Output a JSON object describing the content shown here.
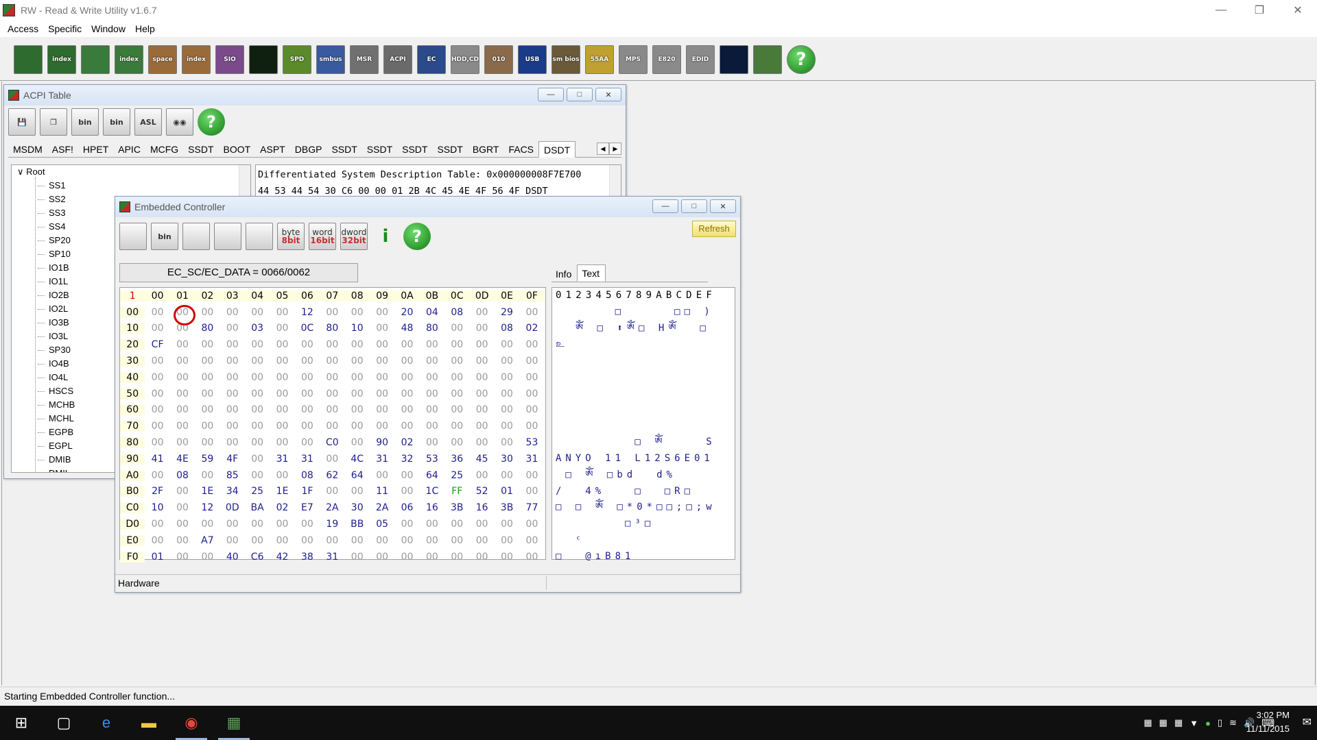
{
  "window": {
    "title": "RW - Read & Write Utility v1.6.7"
  },
  "menu": [
    "Access",
    "Specific",
    "Window",
    "Help"
  ],
  "toolbar": [
    {
      "icon": "pci-icon",
      "label": "",
      "bg": "#2e6b2e"
    },
    {
      "icon": "pci-index-icon",
      "label": "index",
      "bg": "#2e6b2e"
    },
    {
      "icon": "memory-icon",
      "label": "",
      "bg": "#3a7a3a"
    },
    {
      "icon": "memory-index-icon",
      "label": "index",
      "bg": "#3a7a3a"
    },
    {
      "icon": "io-space-icon",
      "label": "space",
      "bg": "#9a6b3a"
    },
    {
      "icon": "io-index-icon",
      "label": "index",
      "bg": "#9a6b3a"
    },
    {
      "icon": "super-io-icon",
      "label": "SIO",
      "bg": "#7a4a8a"
    },
    {
      "icon": "oscilloscope-icon",
      "label": "",
      "bg": "#102010"
    },
    {
      "icon": "spd-icon",
      "label": "SPD",
      "bg": "#5a8a2a"
    },
    {
      "icon": "smbus-icon",
      "label": "smbus",
      "bg": "#3a5aa0"
    },
    {
      "icon": "msr-icon",
      "label": "MSR",
      "bg": "#707070"
    },
    {
      "icon": "acpi-icon",
      "label": "ACPI",
      "bg": "#6a6a6a"
    },
    {
      "icon": "ec-icon",
      "label": "EC",
      "bg": "#2a4a8a"
    },
    {
      "icon": "hdd-icon",
      "label": "HDD,CD",
      "bg": "#8a8a8a"
    },
    {
      "icon": "cmos-icon",
      "label": "010",
      "bg": "#8a6a4a"
    },
    {
      "icon": "usb-icon",
      "label": "USB",
      "bg": "#1a3a8a"
    },
    {
      "icon": "smbios-icon",
      "label": "sm bios",
      "bg": "#6a5a3a"
    },
    {
      "icon": "55aa-icon",
      "label": "55AA",
      "bg": "#c0a030"
    },
    {
      "icon": "mps-icon",
      "label": "MPS",
      "bg": "#8a8a8a"
    },
    {
      "icon": "e820-icon",
      "label": "E820",
      "bg": "#8a8a8a"
    },
    {
      "icon": "edid-icon",
      "label": "EDID",
      "bg": "#8a8a8a"
    },
    {
      "icon": "command-icon",
      "label": "",
      "bg": "#0a1a3a"
    },
    {
      "icon": "battery-icon",
      "label": "",
      "bg": "#4a7a3a"
    }
  ],
  "acpi": {
    "title": "ACPI Table",
    "tabs": [
      "MSDM",
      "ASF!",
      "HPET",
      "APIC",
      "MCFG",
      "SSDT",
      "BOOT",
      "ASPT",
      "DBGP",
      "SSDT",
      "SSDT",
      "SSDT",
      "SSDT",
      "BGRT",
      "FACS",
      "DSDT"
    ],
    "active_tab": 15,
    "tree_root": "Root",
    "tree_items": [
      "SS1",
      "SS2",
      "SS3",
      "SS4",
      "SP20",
      "SP10",
      "IO1B",
      "IO1L",
      "IO2B",
      "IO2L",
      "IO3B",
      "IO3L",
      "SP30",
      "IO4B",
      "IO4L",
      "HSCS",
      "MCHB",
      "MCHL",
      "EGPB",
      "EGPL",
      "DMIB",
      "DMIL"
    ],
    "dump_line1": "Differentiated System Description Table: 0x000000008F7E700",
    "dump_line2": "44 53 44 54 30 C6 00 00 01 2B 4C 45 4E 4F 56 4F DSDT"
  },
  "ec": {
    "title": "Embedded Controller",
    "address": "EC_SC/EC_DATA = 0066/0062",
    "refresh_label": "Refresh",
    "toolbar": [
      {
        "icon": "save-icon",
        "label": ""
      },
      {
        "icon": "load-bin-icon",
        "label": "bin"
      },
      {
        "icon": "copy-icon",
        "label": ""
      },
      {
        "icon": "binoculars-icon",
        "label": ""
      },
      {
        "icon": "table-icon",
        "label": ""
      },
      {
        "icon": "byte-icon",
        "label": "byte",
        "sub": "8bit"
      },
      {
        "icon": "word-icon",
        "label": "word",
        "sub": "16bit"
      },
      {
        "icon": "dword-icon",
        "label": "dword",
        "sub": "32bit"
      },
      {
        "icon": "info-icon",
        "label": "i"
      }
    ],
    "corner": "1",
    "col_headers": [
      "00",
      "01",
      "02",
      "03",
      "04",
      "05",
      "06",
      "07",
      "08",
      "09",
      "0A",
      "0B",
      "0C",
      "0D",
      "0E",
      "0F"
    ],
    "rows": [
      {
        "addr": "00",
        "cells": [
          "00",
          "00",
          "00",
          "00",
          "00",
          "00",
          "12",
          "00",
          "00",
          "00",
          "20",
          "04",
          "08",
          "00",
          "29",
          "00"
        ]
      },
      {
        "addr": "10",
        "cells": [
          "00",
          "00",
          "80",
          "00",
          "03",
          "00",
          "0C",
          "80",
          "10",
          "00",
          "48",
          "80",
          "00",
          "00",
          "08",
          "02"
        ]
      },
      {
        "addr": "20",
        "cells": [
          "CF",
          "00",
          "00",
          "00",
          "00",
          "00",
          "00",
          "00",
          "00",
          "00",
          "00",
          "00",
          "00",
          "00",
          "00",
          "00"
        ]
      },
      {
        "addr": "30",
        "cells": [
          "00",
          "00",
          "00",
          "00",
          "00",
          "00",
          "00",
          "00",
          "00",
          "00",
          "00",
          "00",
          "00",
          "00",
          "00",
          "00"
        ]
      },
      {
        "addr": "40",
        "cells": [
          "00",
          "00",
          "00",
          "00",
          "00",
          "00",
          "00",
          "00",
          "00",
          "00",
          "00",
          "00",
          "00",
          "00",
          "00",
          "00"
        ]
      },
      {
        "addr": "50",
        "cells": [
          "00",
          "00",
          "00",
          "00",
          "00",
          "00",
          "00",
          "00",
          "00",
          "00",
          "00",
          "00",
          "00",
          "00",
          "00",
          "00"
        ]
      },
      {
        "addr": "60",
        "cells": [
          "00",
          "00",
          "00",
          "00",
          "00",
          "00",
          "00",
          "00",
          "00",
          "00",
          "00",
          "00",
          "00",
          "00",
          "00",
          "00"
        ]
      },
      {
        "addr": "70",
        "cells": [
          "00",
          "00",
          "00",
          "00",
          "00",
          "00",
          "00",
          "00",
          "00",
          "00",
          "00",
          "00",
          "00",
          "00",
          "00",
          "00"
        ]
      },
      {
        "addr": "80",
        "cells": [
          "00",
          "00",
          "00",
          "00",
          "00",
          "00",
          "00",
          "C0",
          "00",
          "90",
          "02",
          "00",
          "00",
          "00",
          "00",
          "53"
        ]
      },
      {
        "addr": "90",
        "cells": [
          "41",
          "4E",
          "59",
          "4F",
          "00",
          "31",
          "31",
          "00",
          "4C",
          "31",
          "32",
          "53",
          "36",
          "45",
          "30",
          "31"
        ]
      },
      {
        "addr": "A0",
        "cells": [
          "00",
          "08",
          "00",
          "85",
          "00",
          "00",
          "08",
          "62",
          "64",
          "00",
          "00",
          "64",
          "25",
          "00",
          "00",
          "00"
        ]
      },
      {
        "addr": "B0",
        "cells": [
          "2F",
          "00",
          "1E",
          "34",
          "25",
          "1E",
          "1F",
          "00",
          "00",
          "11",
          "00",
          "1C",
          "FF",
          "52",
          "01",
          "00"
        ]
      },
      {
        "addr": "C0",
        "cells": [
          "10",
          "00",
          "12",
          "0D",
          "BA",
          "02",
          "E7",
          "2A",
          "30",
          "2A",
          "06",
          "16",
          "3B",
          "16",
          "3B",
          "77"
        ]
      },
      {
        "addr": "D0",
        "cells": [
          "00",
          "00",
          "00",
          "00",
          "00",
          "00",
          "00",
          "19",
          "BB",
          "05",
          "00",
          "00",
          "00",
          "00",
          "00",
          "00"
        ]
      },
      {
        "addr": "E0",
        "cells": [
          "00",
          "00",
          "A7",
          "00",
          "00",
          "00",
          "00",
          "00",
          "00",
          "00",
          "00",
          "00",
          "00",
          "00",
          "00",
          "00"
        ]
      },
      {
        "addr": "F0",
        "cells": [
          "01",
          "00",
          "00",
          "40",
          "C6",
          "42",
          "38",
          "31",
          "00",
          "00",
          "00",
          "00",
          "00",
          "00",
          "00",
          "00"
        ]
      }
    ],
    "info_tabs": [
      "Info",
      "Text"
    ],
    "active_info_tab": 1,
    "text_header": "0123456789ABCDEF",
    "text_rows": [
      "      □     □□ )",
      "  ༀ □ ⬆ༀ□ Hༀ  □",
      "உ",
      "",
      "",
      "",
      "",
      "",
      "        □ ༀ    S",
      "ANYO 11 L12S6E01",
      " □ ༀ □bd  d%",
      "/  4%   □  □R□",
      "□ □ ༀ □*0*□□;□;w",
      "       □³□",
      "  ᶜ",
      "□  @ıB81"
    ],
    "status": "Hardware"
  },
  "status_bar": "Starting Embedded Controller function...",
  "taskbar": {
    "time": "3:02 PM",
    "date": "11/11/2015",
    "apps": [
      {
        "icon": "start-icon",
        "glyph": "⊞"
      },
      {
        "icon": "task-view-icon",
        "glyph": "▢"
      },
      {
        "icon": "edge-icon",
        "glyph": "e"
      },
      {
        "icon": "file-explorer-icon",
        "glyph": "▬"
      },
      {
        "icon": "chrome-icon",
        "glyph": "◉"
      },
      {
        "icon": "rw-utility-icon",
        "glyph": "▦"
      }
    ]
  }
}
